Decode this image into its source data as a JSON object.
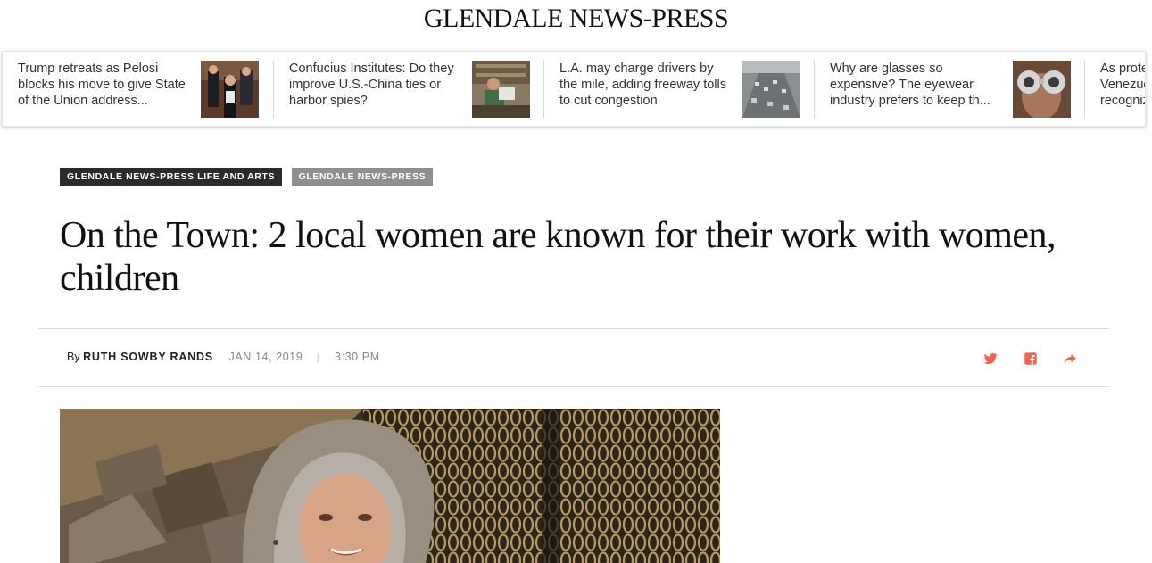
{
  "masthead": {
    "title": "GLENDALE NEWS-PRESS"
  },
  "headlines": [
    {
      "text": "Trump retreats as Pelosi blocks his move to give State of the Union address..."
    },
    {
      "text": "Confucius Institutes: Do they improve U.S.-China ties or harbor spies?"
    },
    {
      "text": "L.A. may charge drivers by the mile, adding freeway tolls to cut congestion"
    },
    {
      "text": "Why are glasses so expensive? The eyewear industry prefers to keep th..."
    },
    {
      "text": "As protesters flood Venezuela's streets, U.S. recognizes..."
    }
  ],
  "tags": [
    {
      "label": "GLENDALE NEWS-PRESS LIFE AND ARTS"
    },
    {
      "label": "GLENDALE NEWS-PRESS"
    }
  ],
  "article": {
    "title": "On the Town: 2 local women are known for their work with women, children",
    "by_prefix": "By",
    "author": "RUTH SOWBY RANDS",
    "date": "JAN 14, 2019",
    "separator": "|",
    "time": "3:30 PM"
  },
  "share_icons": [
    "twitter-icon",
    "facebook-icon",
    "share-icon"
  ],
  "colors": {
    "share_accent": "#f0644f",
    "tag_dark": "#2b2b2b",
    "tag_gray": "#8f8f8f"
  }
}
